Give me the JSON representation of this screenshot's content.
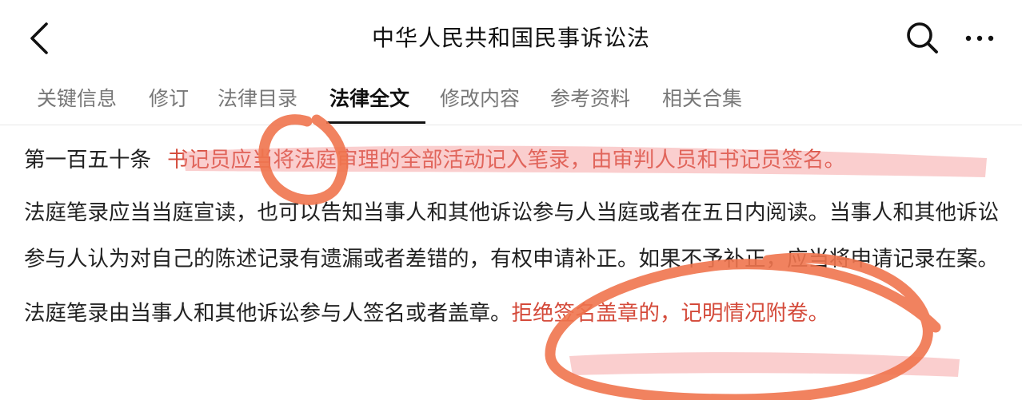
{
  "header": {
    "title": "中华人民共和国民事诉讼法",
    "back_icon": "chevron-left-icon",
    "search_icon": "search-icon",
    "more_icon": "more-horizontal-icon"
  },
  "tabs": [
    {
      "label": "关键信息",
      "active": false
    },
    {
      "label": "修订",
      "active": false
    },
    {
      "label": "法律目录",
      "active": false
    },
    {
      "label": "法律全文",
      "active": true
    },
    {
      "label": "修改内容",
      "active": false
    },
    {
      "label": "参考资料",
      "active": false
    },
    {
      "label": "相关合集",
      "active": false
    }
  ],
  "article": {
    "number": "第一百五十条",
    "p1_highlight": "书记员应当将法庭审理的全部活动记入笔录，由审判人员和书记员签名。",
    "p2": "法庭笔录应当当庭宣读，也可以告知当事人和其他诉讼参与人当庭或者在五日内阅读。当事人和其他诉讼参与人认为对自己的陈述记录有遗漏或者差错的，有权申请补正。如果不予补正，应当将申请记录在案。",
    "p3_normal": "法庭笔录由当事人和其他诉讼参与人签名或者盖章。",
    "p3_highlight": "拒绝签名盖章的，记明情况附卷。"
  },
  "colors": {
    "highlight_text": "#d44a3a",
    "marker_pink": "#f28b8b",
    "pen_orange": "#f0744e",
    "active_tab": "#111111",
    "inactive_tab": "#777777"
  }
}
